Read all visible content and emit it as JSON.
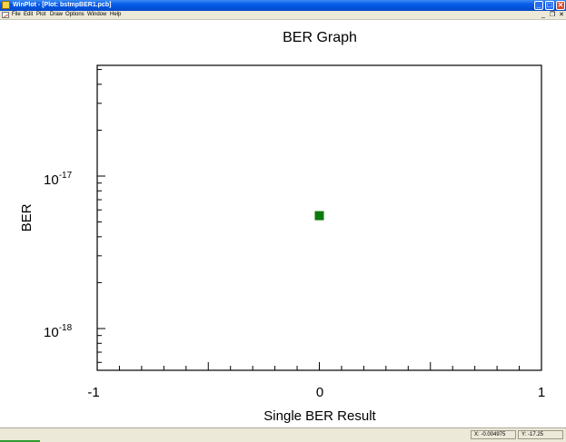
{
  "window": {
    "title": "WinPlot - [Plot: bstmpBER1.pcb]",
    "controls": {
      "minimize": "_",
      "maximize": "□",
      "close": "✕"
    }
  },
  "menu": {
    "items": [
      "File",
      "Edit",
      "Plot",
      "Draw",
      "Options",
      "Window",
      "Help"
    ],
    "mdi_controls": {
      "minimize": "_",
      "restore": "❐",
      "close": "✕"
    }
  },
  "chart_data": {
    "type": "scatter",
    "title": "BER Graph",
    "xlabel": "Single BER Result",
    "ylabel": "BER",
    "xlim": [
      -1,
      1
    ],
    "x_ticks": [
      "-1",
      "0",
      "1"
    ],
    "y_scale": "log",
    "y_ticks": [
      {
        "base": "10",
        "exp": "-17"
      },
      {
        "base": "10",
        "exp": "-18"
      }
    ],
    "points": [
      {
        "x": 0,
        "y": 5.5e-18
      }
    ],
    "marker_color": "#0b7a0b",
    "grid": false
  },
  "status": {
    "x_readout": "X: -0.004975",
    "y_readout": "Y: -17.25"
  }
}
